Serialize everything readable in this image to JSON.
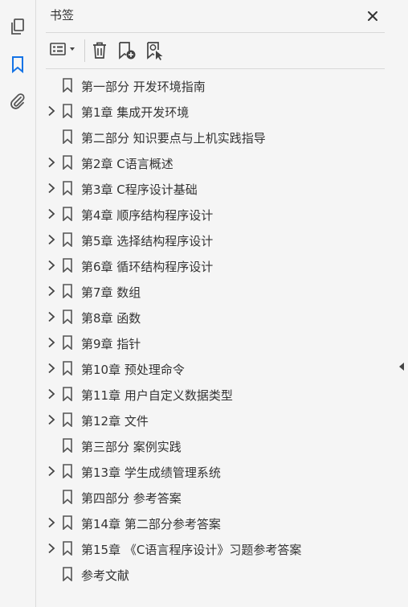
{
  "panel": {
    "title": "书签"
  },
  "bookmarks": [
    {
      "label": "第一部分 开发环境指南",
      "expandable": false
    },
    {
      "label": "第1章 集成开发环境",
      "expandable": true
    },
    {
      "label": "第二部分 知识要点与上机实践指导",
      "expandable": false
    },
    {
      "label": "第2章 C语言概述",
      "expandable": true
    },
    {
      "label": "第3章 C程序设计基础",
      "expandable": true
    },
    {
      "label": "第4章 顺序结构程序设计",
      "expandable": true
    },
    {
      "label": "第5章 选择结构程序设计",
      "expandable": true
    },
    {
      "label": "第6章 循环结构程序设计",
      "expandable": true
    },
    {
      "label": "第7章 数组",
      "expandable": true
    },
    {
      "label": "第8章 函数",
      "expandable": true
    },
    {
      "label": "第9章 指针",
      "expandable": true
    },
    {
      "label": "第10章 预处理命令",
      "expandable": true
    },
    {
      "label": "第11章 用户自定义数据类型",
      "expandable": true
    },
    {
      "label": "第12章 文件",
      "expandable": true
    },
    {
      "label": "第三部分 案例实践",
      "expandable": false
    },
    {
      "label": "第13章 学生成绩管理系统",
      "expandable": true
    },
    {
      "label": "第四部分 参考答案",
      "expandable": false
    },
    {
      "label": "第14章 第二部分参考答案",
      "expandable": true
    },
    {
      "label": "第15章 《C语言程序设计》习题参考答案",
      "expandable": true
    },
    {
      "label": "参考文献",
      "expandable": false
    }
  ],
  "icons": {
    "rail": [
      "pages-icon",
      "bookmarks-icon",
      "attachments-icon"
    ],
    "toolbar": [
      "options-menu-icon",
      "delete-bookmark-icon",
      "new-bookmark-icon",
      "new-bookmark-from-structure-icon"
    ]
  },
  "colors": {
    "accent": "#1473e6",
    "icon": "#555555",
    "background": "#f5f5f5"
  }
}
